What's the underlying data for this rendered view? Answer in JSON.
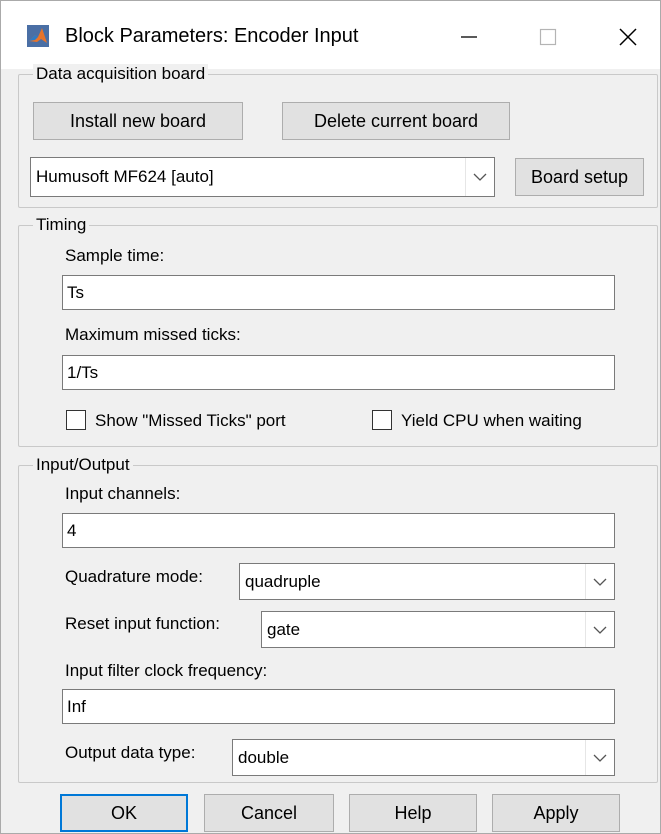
{
  "window": {
    "title": "Block Parameters: Encoder Input"
  },
  "dac": {
    "legend": "Data acquisition board",
    "install_label": "Install new board",
    "delete_label": "Delete current board",
    "board_value": "Humusoft MF624 [auto]",
    "setup_label": "Board setup"
  },
  "timing": {
    "legend": "Timing",
    "sample_time_label": "Sample time:",
    "sample_time_value": "Ts",
    "max_missed_label": "Maximum missed ticks:",
    "max_missed_value": "1/Ts",
    "show_missed_label": "Show \"Missed Ticks\" port",
    "show_missed_checked": false,
    "yield_cpu_label": "Yield CPU when waiting",
    "yield_cpu_checked": false
  },
  "io": {
    "legend": "Input/Output",
    "channels_label": "Input channels:",
    "channels_value": "4",
    "quadrature_label": "Quadrature mode:",
    "quadrature_value": "quadruple",
    "reset_label": "Reset input function:",
    "reset_value": "gate",
    "filter_label": "Input filter clock frequency:",
    "filter_value": "Inf",
    "output_type_label": "Output data type:",
    "output_type_value": "double"
  },
  "footer": {
    "ok_label": "OK",
    "cancel_label": "Cancel",
    "help_label": "Help",
    "apply_label": "Apply"
  },
  "icons": {
    "app": "matlab-logo-icon",
    "minimize": "minimize-icon",
    "maximize": "maximize-icon",
    "close": "close-icon",
    "dropdown": "chevron-down-icon"
  },
  "colors": {
    "accent": "#0078d7",
    "background": "#f0f0f0"
  }
}
